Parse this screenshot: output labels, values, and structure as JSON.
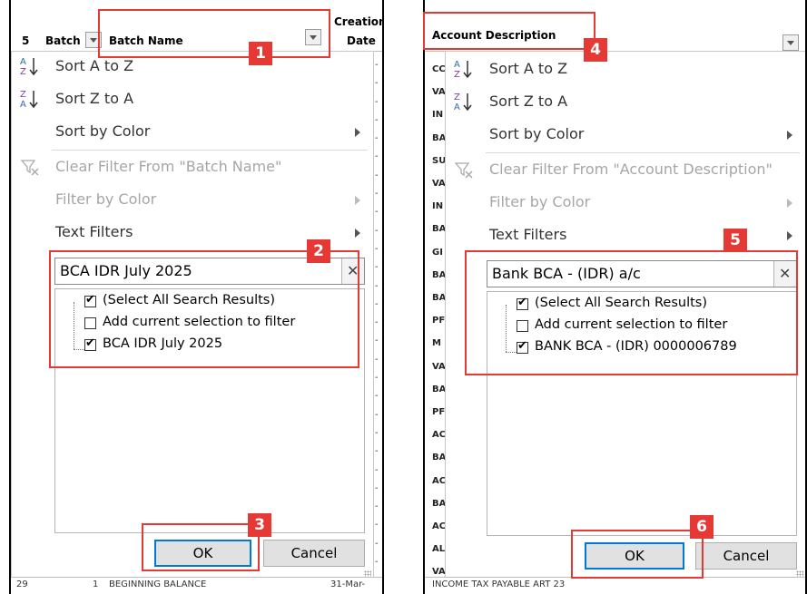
{
  "left_panel": {
    "header": {
      "row_num": "5",
      "col_batch": "Batch",
      "col_batch_name": "Batch Name",
      "col_creation_line1": "Creation",
      "col_creation_line2": "Date"
    },
    "menu": {
      "sort_az": "Sort A to Z",
      "sort_za": "Sort Z to A",
      "sort_by_color": "Sort by Color",
      "clear_filter": "Clear Filter From \"Batch Name\"",
      "filter_by_color": "Filter by Color",
      "text_filters": "Text Filters"
    },
    "search": {
      "value": "BCA IDR July 2025"
    },
    "list": [
      {
        "label": "(Select All Search Results)",
        "checked": true
      },
      {
        "label": "Add current selection to filter",
        "checked": false
      },
      {
        "label": "BCA IDR July 2025",
        "checked": true
      }
    ],
    "buttons": {
      "ok": "OK",
      "cancel": "Cancel"
    },
    "footer": {
      "row_num": "29",
      "batch": "1",
      "batch_name": "BEGINNING BALANCE",
      "date": "31-Mar-"
    }
  },
  "right_panel": {
    "header": {
      "col_account_description": "Account Description"
    },
    "behind_cells": [
      "CC",
      "VA",
      "IN",
      "BA",
      "SU",
      "VA",
      "IN",
      "BA",
      "GI",
      "BA",
      "BA",
      "PF",
      "M",
      "VA",
      "BA",
      "PF",
      "AC",
      "BA",
      "AC",
      "BA",
      "AC",
      "AL",
      "VA"
    ],
    "menu": {
      "sort_az": "Sort A to Z",
      "sort_za": "Sort Z to A",
      "sort_by_color": "Sort by Color",
      "clear_filter": "Clear Filter From \"Account Description\"",
      "filter_by_color": "Filter by Color",
      "text_filters": "Text Filters"
    },
    "search": {
      "value": "Bank BCA - (IDR) a/c "
    },
    "list": [
      {
        "label": "(Select All Search Results)",
        "checked": true
      },
      {
        "label": "Add current selection to filter",
        "checked": false
      },
      {
        "label": "BANK BCA - (IDR) 0000006789",
        "checked": true
      }
    ],
    "buttons": {
      "ok": "OK",
      "cancel": "Cancel"
    },
    "footer": {
      "text": "INCOME TAX PAYABLE ART 23"
    }
  },
  "callouts": [
    "1",
    "2",
    "3",
    "4",
    "5",
    "6"
  ],
  "colors": {
    "callout": "#e53935",
    "ok_focus": "#0078d7"
  }
}
